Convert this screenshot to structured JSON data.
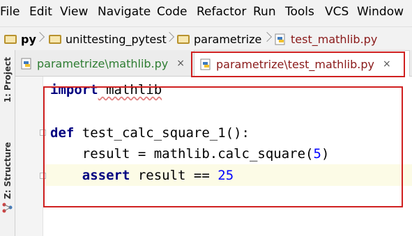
{
  "menu": [
    "File",
    "Edit",
    "View",
    "Navigate",
    "Code",
    "Refactor",
    "Run",
    "Tools",
    "VCS",
    "Window"
  ],
  "breadcrumbs": [
    "py",
    "unittesting_pytest",
    "parametrize",
    "test_mathlib.py"
  ],
  "tabs": [
    {
      "label": "parametrize\\mathlib.py",
      "close": "×"
    },
    {
      "label": "parametrize\\test_mathlib.py",
      "close": "×"
    }
  ],
  "tool_windows": [
    "1: Project",
    "Z: Structure"
  ],
  "code": {
    "line1": {
      "kw": "import",
      "rest": " mathlib"
    },
    "line2": {
      "kw": "def",
      "rest": " test_calc_square_1():"
    },
    "line3": {
      "text": "    result = mathlib.calc_square(",
      "num": "5",
      "tail": ")"
    },
    "line4": {
      "indent": "    ",
      "kw": "assert",
      "rest": " result == ",
      "num": "25"
    }
  },
  "colors": {
    "keyword": "#000080",
    "number": "#0000ff",
    "annotation": "#d02020",
    "tab_active_text": "#8a1a1a",
    "tab_inactive_text": "#2e7d32"
  }
}
